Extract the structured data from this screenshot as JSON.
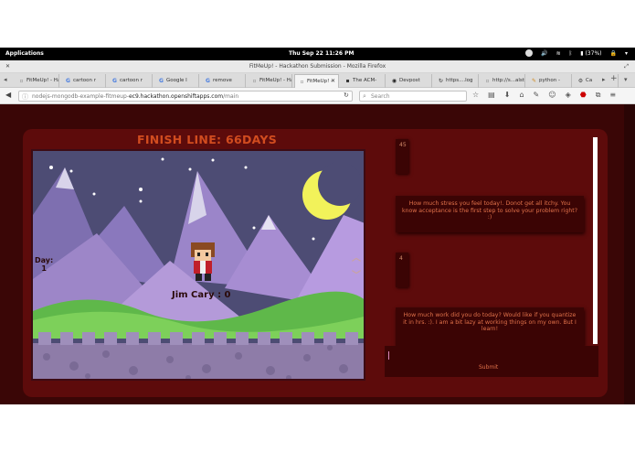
{
  "gnome_bar": {
    "applications": "Applications",
    "clock": "Thu Sep 22   11:26 PM",
    "battery": "(37%)"
  },
  "window": {
    "title": "FitMeUp! - Hackathon Submission - Mozilla Firefox"
  },
  "tabs": [
    {
      "label": "FitMeUp! - Ha",
      "icon": "page-icon"
    },
    {
      "label": "cartoon r",
      "icon": "google-icon"
    },
    {
      "label": "cartoon r",
      "icon": "google-icon"
    },
    {
      "label": "Google I",
      "icon": "google-icon"
    },
    {
      "label": "remove",
      "icon": "google-icon"
    },
    {
      "label": "FitMeUp! - Ha",
      "icon": "page-icon"
    },
    {
      "label": "FitMeUp! -",
      "icon": "page-icon",
      "active": true
    },
    {
      "label": "The ACM-",
      "icon": "acm-icon"
    },
    {
      "label": "Devpost",
      "icon": "devpost-icon"
    },
    {
      "label": "https....log",
      "icon": "loading-icon"
    },
    {
      "label": "http://s...alstats",
      "icon": "page-icon"
    },
    {
      "label": "python -",
      "icon": "pencil-icon"
    },
    {
      "label": "Ca",
      "icon": "gear-icon"
    }
  ],
  "nav": {
    "url_prefix": "nodejs-mongodb-example-fitmeup-",
    "url_host": "ec9.hackathon.openshiftapps.com",
    "url_path": "/main",
    "search_placeholder": "Search"
  },
  "page": {
    "finish_line": "FINISH LINE: 66DAYS",
    "day_label": "Day:",
    "day_value": "1",
    "player_name": "Jim Cary : 0",
    "stress_value": "45",
    "stress_question": "How much stress you feel today!. Donot get all itchy. You know acceptance is the first step to solve your problem right? :)",
    "work_value": "4",
    "work_question": "How much work did you do today? Would like if you quantize it in hrs. :). I am a bit lazy at working things on my own. But I learn!",
    "submit_label": "Submit"
  },
  "colors": {
    "page_bg": "#3a0606",
    "panel_bg": "#5d0b0b",
    "accent_orange": "#d14c1f",
    "moon": "#f2f25a"
  }
}
